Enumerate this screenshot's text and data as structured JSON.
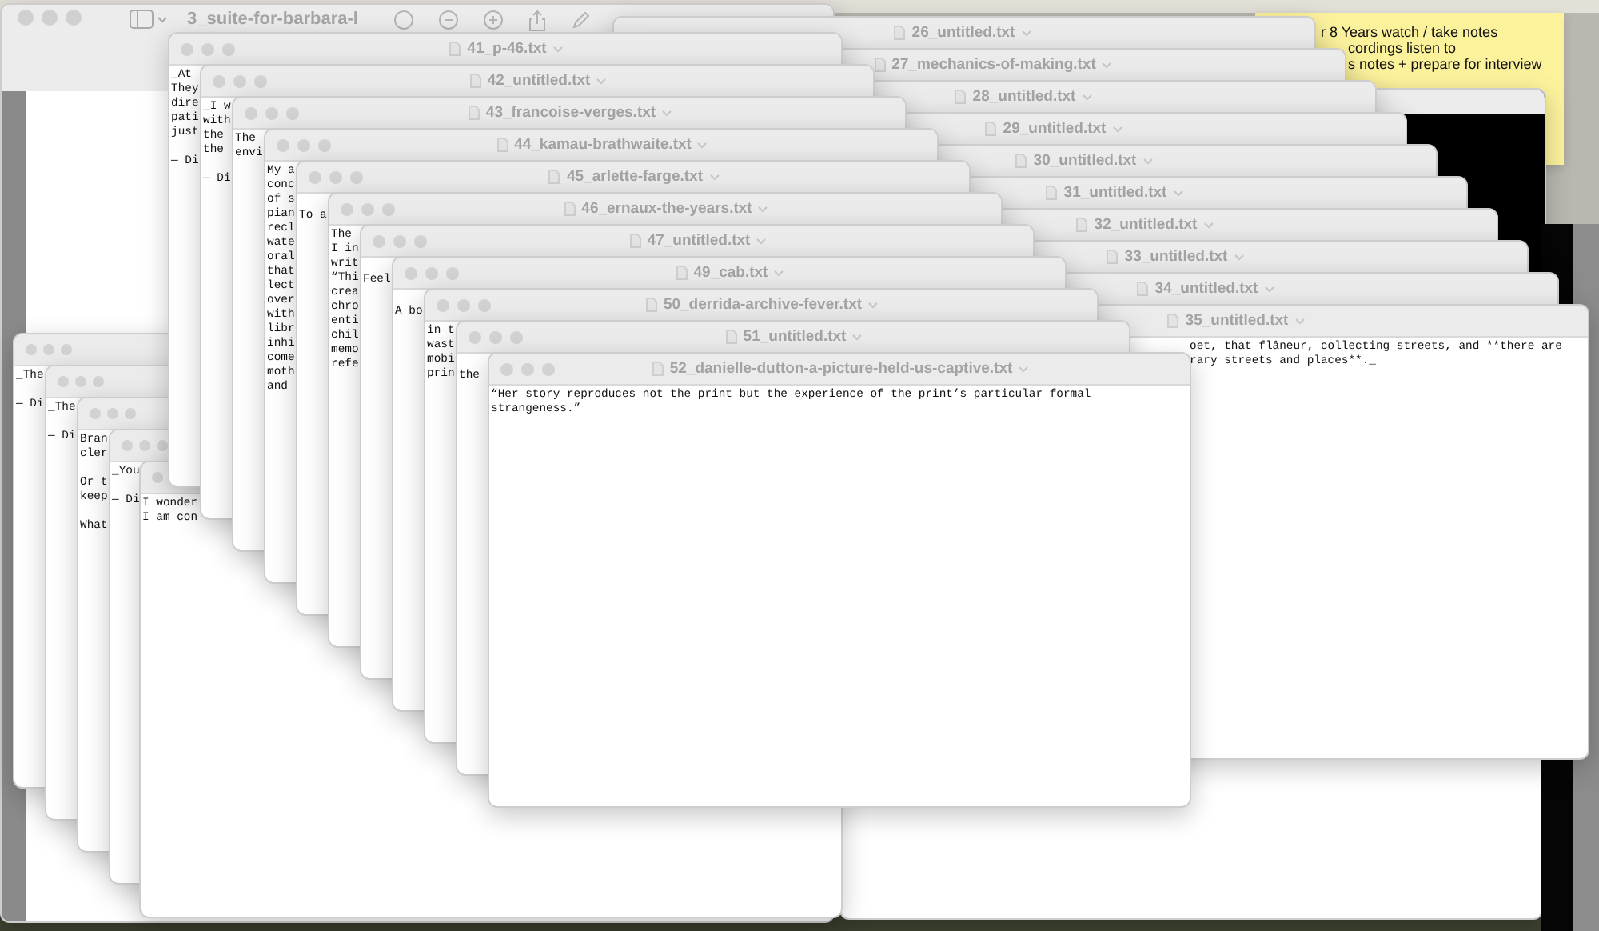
{
  "back_window": {
    "title": "3_suite-for-barbara-l"
  },
  "sticky_note": {
    "text": "r 8 Years watch / take notes\ncordings listen to\ns notes + prepare for interview"
  },
  "right_windows": [
    {
      "title": "26_untitled.txt"
    },
    {
      "title": "27_mechanics-of-making.txt"
    },
    {
      "title": "28_untitled.txt"
    },
    {
      "title": "29_untitled.txt"
    },
    {
      "title": "30_untitled.txt"
    },
    {
      "title": "31_untitled.txt"
    },
    {
      "title": "32_untitled.txt"
    },
    {
      "title": "33_untitled.txt"
    },
    {
      "title": "34_untitled.txt"
    },
    {
      "title": "35_untitled.txt",
      "text": "oet, that flâneur, collecting streets, and **there are\nrary streets and places**._"
    }
  ],
  "small_windows": [
    {
      "text": "_The\n\n— Di"
    },
    {
      "text": "_The\n\n— Di"
    },
    {
      "text": "Bran\ncler\n\nOr t\nkeep\n\nWhat"
    },
    {
      "text": "_You\n\n— Di"
    },
    {
      "text": "I wonder\nI am con"
    }
  ],
  "left_windows": [
    {
      "title": "41_p-46.txt",
      "text": "_At\nThey\ndire\npati\njust\n\n— Di"
    },
    {
      "title": "42_untitled.txt",
      "text": "_I w\nwith\nthe\nthe\n\n— Di"
    },
    {
      "title": "43_francoise-verges.txt",
      "text": "The\nenvi"
    },
    {
      "title": "44_kamau-brathwaite.txt",
      "text": "My a\nconc\nof s\npian\nrecl\nwate\noral\nthat\nlect\nover\nwith\nlibr\ninhi\ncome\nmoth\nand"
    },
    {
      "title": "45_arlette-farge.txt",
      "text": "To a"
    },
    {
      "title": "46_ernaux-the-years.txt",
      "text": "The\nI in\nwrit\n“Thi\ncrea\nchro\nenti\nchil\nmemo\nrefe"
    },
    {
      "title": "47_untitled.txt",
      "text": "Feel"
    },
    {
      "title": "49_cab.txt",
      "text": "A bo"
    },
    {
      "title": "50_derrida-archive-fever.txt",
      "text": "in t\nwast\nmobi\nprin"
    },
    {
      "title": "51_untitled.txt",
      "text": "the"
    },
    {
      "title": "52_danielle-dutton-a-picture-held-us-captive.txt",
      "text": "“Her story reproduces not the print but the experience of the print’s particular formal\nstrangeness.”"
    }
  ]
}
